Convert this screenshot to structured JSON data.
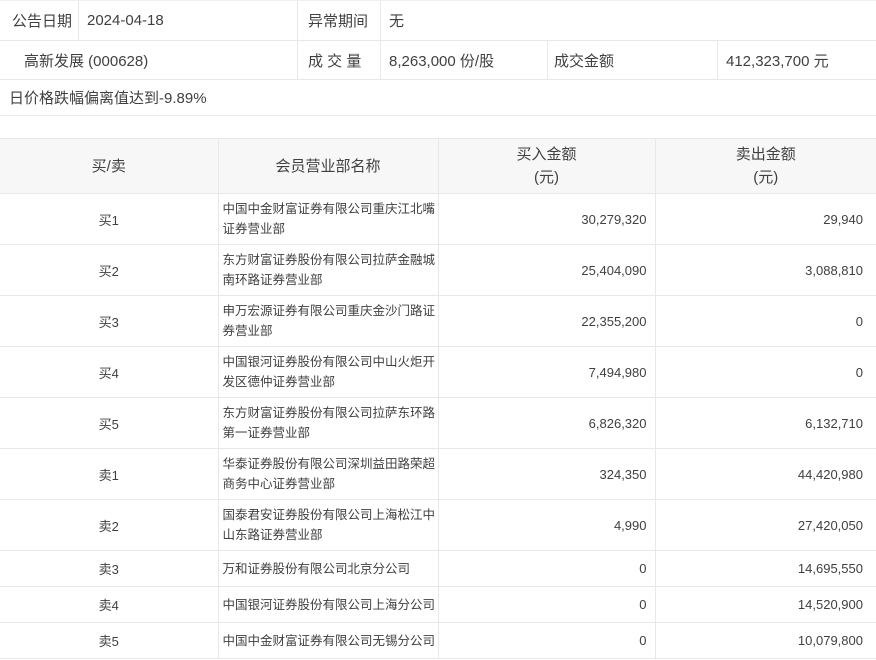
{
  "colors": {
    "border": "#e8e8e8",
    "border_light": "#f0f0f0",
    "header_bg": "#f7f7f7",
    "text": "#404040"
  },
  "info": {
    "announce_date_label": "公告日期",
    "announce_date": "2024-04-18",
    "abnormal_period_label": "异常期间",
    "abnormal_period": "无",
    "stock_name": "高新发展 (000628)",
    "volume_label": "成 交 量",
    "volume": "8,263,000 份/股",
    "turnover_label": "成交金额",
    "turnover": "412,323,700 元",
    "deviation_note": "日价格跌幅偏离值达到-9.89%"
  },
  "table": {
    "headers": {
      "side": "买/卖",
      "broker": "会员营业部名称",
      "buy": "买入金额",
      "sell": "卖出金额",
      "unit": "(元)"
    },
    "rows": [
      {
        "side": "买1",
        "broker": "中国中金财富证券有限公司重庆江北嘴证券营业部",
        "buy": "30,279,320",
        "sell": "29,940"
      },
      {
        "side": "买2",
        "broker": "东方财富证券股份有限公司拉萨金融城南环路证券营业部",
        "buy": "25,404,090",
        "sell": "3,088,810"
      },
      {
        "side": "买3",
        "broker": "申万宏源证券有限公司重庆金沙门路证券营业部",
        "buy": "22,355,200",
        "sell": "0"
      },
      {
        "side": "买4",
        "broker": "中国银河证券股份有限公司中山火炬开发区德仲证券营业部",
        "buy": "7,494,980",
        "sell": "0"
      },
      {
        "side": "买5",
        "broker": "东方财富证券股份有限公司拉萨东环路第一证券营业部",
        "buy": "6,826,320",
        "sell": "6,132,710"
      },
      {
        "side": "卖1",
        "broker": "华泰证券股份有限公司深圳益田路荣超商务中心证券营业部",
        "buy": "324,350",
        "sell": "44,420,980"
      },
      {
        "side": "卖2",
        "broker": "国泰君安证券股份有限公司上海松江中山东路证券营业部",
        "buy": "4,990",
        "sell": "27,420,050"
      },
      {
        "side": "卖3",
        "broker": "万和证券股份有限公司北京分公司",
        "buy": "0",
        "sell": "14,695,550"
      },
      {
        "side": "卖4",
        "broker": "中国银河证券股份有限公司上海分公司",
        "buy": "0",
        "sell": "14,520,900"
      },
      {
        "side": "卖5",
        "broker": "中国中金财富证券有限公司无锡分公司",
        "buy": "0",
        "sell": "10,079,800"
      }
    ]
  }
}
